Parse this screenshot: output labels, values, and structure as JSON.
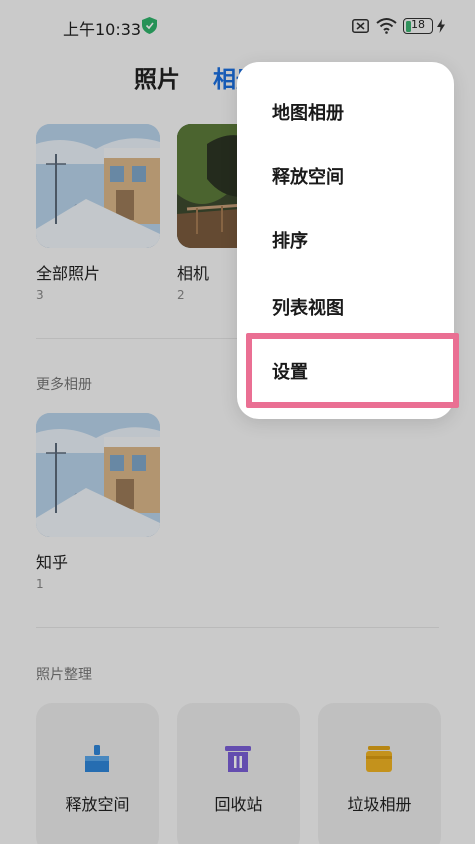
{
  "status_bar": {
    "time": "上午10:33",
    "battery_level": "18",
    "icons": [
      "shield-icon",
      "sim-icon",
      "wifi-icon",
      "battery-icon",
      "charging-icon"
    ]
  },
  "header": {
    "tabs": [
      {
        "label": "照片",
        "active": false
      },
      {
        "label": "相册",
        "active": true
      }
    ]
  },
  "albums": [
    {
      "name": "全部照片",
      "count": "3"
    },
    {
      "name": "相机",
      "count": "2"
    }
  ],
  "more_albums": {
    "title": "更多相册",
    "items": [
      {
        "name": "知乎",
        "count": "1"
      }
    ]
  },
  "organize": {
    "title": "照片整理",
    "tools": [
      {
        "label": "释放空间",
        "icon": "broom-icon",
        "color": "#2f86d8"
      },
      {
        "label": "回收站",
        "icon": "trash-icon",
        "color": "#7b5fd6"
      },
      {
        "label": "垃圾相册",
        "icon": "folder-icon",
        "color": "#f0b323"
      }
    ]
  },
  "menu": {
    "items": [
      {
        "label": "地图相册"
      },
      {
        "label": "释放空间"
      },
      {
        "label": "排序"
      },
      {
        "label": "列表视图"
      },
      {
        "label": "设置",
        "highlighted": true
      }
    ],
    "highlight_color": "#ea6f93"
  },
  "colors": {
    "accent": "#1b6fe0",
    "background": "#f7f7f7"
  }
}
